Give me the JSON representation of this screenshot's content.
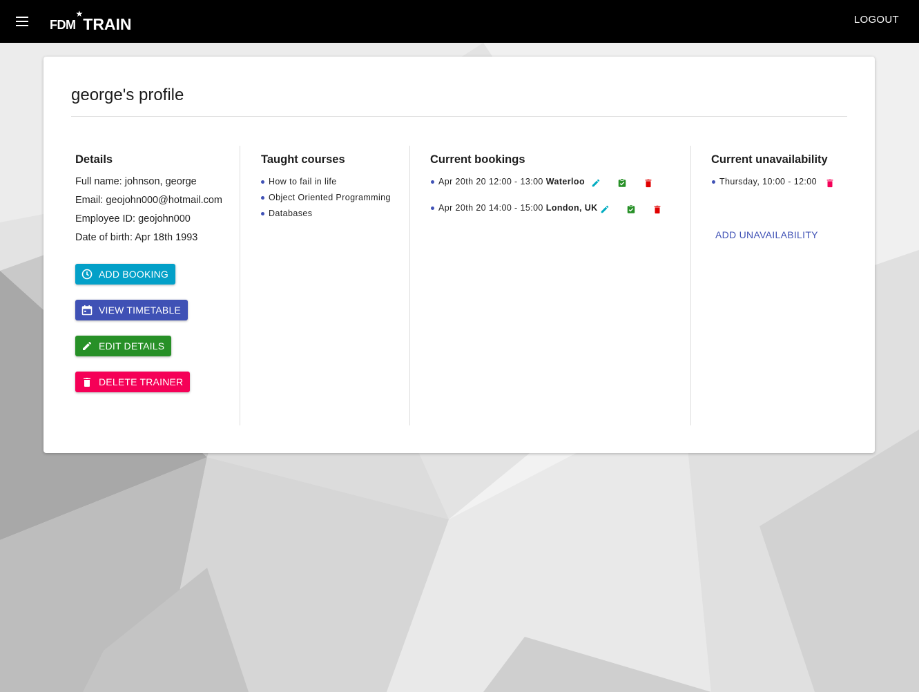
{
  "appbar": {
    "logo_prefix": "FDM",
    "logo_star": "★",
    "logo_suffix": "TRAIN",
    "logout_label": "LOGOUT"
  },
  "profile": {
    "title": "george's profile"
  },
  "details": {
    "heading": "Details",
    "full_name": "Full name: johnson, george",
    "email": "Email: geojohn000@hotmail.com",
    "employee_id": "Employee ID: geojohn000",
    "date_of_birth": "Date of birth: Apr 18th 1993",
    "buttons": {
      "add_booking": "ADD BOOKING",
      "view_timetable": "VIEW TIMETABLE",
      "edit_details": "EDIT DETAILS",
      "delete_trainer": "DELETE TRAINER"
    }
  },
  "taught_courses": {
    "heading": "Taught courses",
    "items": [
      "How to fail in life",
      "Object Oriented Programming",
      "Databases"
    ]
  },
  "bookings": {
    "heading": "Current bookings",
    "items": [
      {
        "time": "Apr 20th 20 12:00 - 13:00",
        "location": "Waterloo"
      },
      {
        "time": "Apr 20th 20 14:00 - 15:00",
        "location": "London, UK"
      }
    ]
  },
  "unavailability": {
    "heading": "Current unavailability",
    "items": [
      {
        "time": "Thursday, 10:00 - 12:00"
      }
    ],
    "add_label": "ADD UNAVAILABILITY"
  },
  "colors": {
    "appbar": "#000000",
    "add_booking": "#03a0c8",
    "view_timetable": "#3f51b5",
    "edit_details": "#279027",
    "delete_trainer": "#f50057",
    "edit_icon": "#00acc1",
    "confirm_icon": "#279027",
    "delete_icon_booking": "#e00000",
    "delete_icon_unavailability": "#f50057",
    "link": "#3f51b5"
  },
  "icons": {
    "menu": "menu-icon",
    "add_booking": "clock-icon",
    "view_timetable": "calendar-icon",
    "edit_details": "pencil-icon",
    "delete_trainer": "trash-icon",
    "booking_edit": "pencil-icon",
    "booking_confirm": "check-badge-icon",
    "booking_delete": "trash-icon"
  }
}
